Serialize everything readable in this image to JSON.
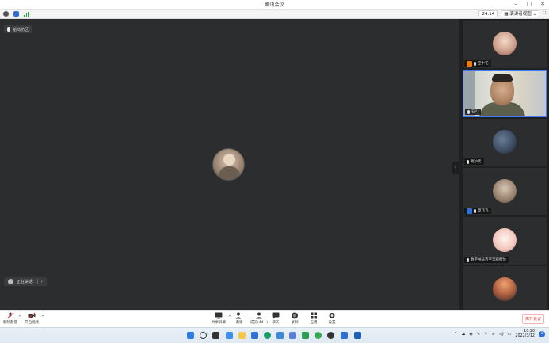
{
  "window": {
    "title": "腾讯会议"
  },
  "infobar": {
    "view_label": "24:14",
    "layout_label": "演讲者视图"
  },
  "main": {
    "speaker_tag": "船坞防区",
    "speaking_label": "正在讲话:"
  },
  "participants": [
    {
      "name": "空中花",
      "badge": "host",
      "badge_color": "#f07d00"
    },
    {
      "name": "石山",
      "badge": "none",
      "badge_color": ""
    },
    {
      "name": "啊沙卖",
      "badge": "none",
      "badge_color": ""
    },
    {
      "name": "莫飞飞",
      "badge": "cohost",
      "badge_color": "#2f6fd6"
    },
    {
      "name": "数字书法百字宫殿楷体",
      "badge": "none",
      "badge_color": ""
    },
    {
      "name": "",
      "badge": "none",
      "badge_color": ""
    }
  ],
  "toolbar": {
    "mute_label": "解除静音",
    "video_label": "开启视频",
    "share_label": "共享屏幕",
    "invite_label": "邀请",
    "members_label": "成员(44+)",
    "chat_label": "聊天",
    "record_label": "录制",
    "apps_label": "应用",
    "settings_label": "设置",
    "end_label": "离开会议"
  },
  "taskbar": {
    "time": "10:20",
    "date": "2022/3/12",
    "notifications": "1"
  },
  "colors": {
    "accent": "#3d7bff",
    "danger": "#e23b3b",
    "video_bg": "#2c2d2f"
  }
}
